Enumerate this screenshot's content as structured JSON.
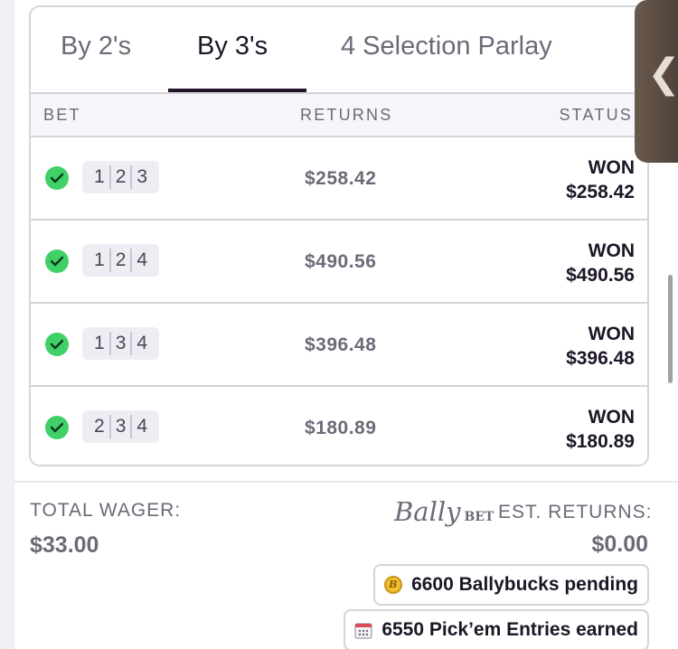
{
  "tabs": [
    {
      "label": "By 2's"
    },
    {
      "label": "By 3's"
    },
    {
      "label": "4 Selection Parlay"
    }
  ],
  "active_tab": "By 3's",
  "table": {
    "headers": [
      "BET",
      "RETURNS",
      "STATUS"
    ],
    "rows": [
      {
        "legs": [
          "1",
          "2",
          "3"
        ],
        "returns": "$258.42",
        "status": "WON",
        "status_amount": "$258.42"
      },
      {
        "legs": [
          "1",
          "2",
          "4"
        ],
        "returns": "$490.56",
        "status": "WON",
        "status_amount": "$490.56"
      },
      {
        "legs": [
          "1",
          "3",
          "4"
        ],
        "returns": "$396.48",
        "status": "WON",
        "status_amount": "$396.48"
      },
      {
        "legs": [
          "2",
          "3",
          "4"
        ],
        "returns": "$180.89",
        "status": "WON",
        "status_amount": "$180.89"
      }
    ]
  },
  "footer": {
    "total_wager_label": "TOTAL WAGER:",
    "total_wager_value": "$33.00",
    "brand_script": "Bally",
    "brand_bet": "BET",
    "est_returns_label": "EST. RETURNS:",
    "est_returns_value": "$0.00",
    "ballybucks": "6600 Ballybucks pending",
    "pickem": "6550 Pick’em Entries earned"
  },
  "colors": {
    "check": "#3fd068",
    "text_dark": "#1d1626",
    "text_muted": "#6d6a78",
    "border": "#d6d4dc"
  }
}
